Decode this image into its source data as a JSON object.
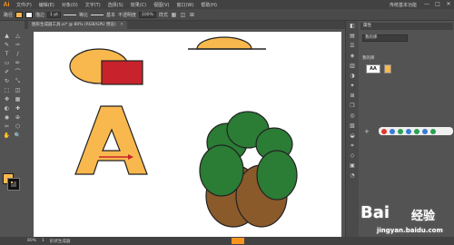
{
  "app": {
    "logo": "Ai"
  },
  "menu": {
    "items": [
      "文件(F)",
      "编辑(E)",
      "对象(O)",
      "文字(T)",
      "选择(S)",
      "效果(C)",
      "视图(V)",
      "窗口(W)",
      "帮助(H)"
    ]
  },
  "window": {
    "workspace": "传统基本功能",
    "minimize": "—",
    "maximize": "□",
    "close": "✕"
  },
  "control": {
    "selection_label": "路径",
    "stroke_label": "描边",
    "stroke_weight": "1 pt",
    "uniform_label": "等比",
    "basic_label": "基本",
    "opacity_label": "不透明度",
    "opacity_value": "100%",
    "style_label": "样式"
  },
  "document": {
    "tab_title": "图形生成器工具.ai* @ 80% (RGB/GPU 预览)",
    "close": "✕",
    "left_label": "显示设置"
  },
  "toolbar": {
    "tools": [
      "▲",
      "△",
      "✎",
      "✑",
      "T",
      "/",
      "▭",
      "✏",
      "✐",
      "⌒",
      "↻",
      "⤡",
      "⬚",
      "◫",
      "✥",
      "▦",
      "◐",
      "✚",
      "◉",
      "⊕",
      "✂",
      "⬡",
      "✋",
      "🔍"
    ]
  },
  "panel": {
    "header": "属性",
    "dropdown": "我的库",
    "library_title": "我的库",
    "library_item_text": "AA",
    "strip_icons": [
      "◧",
      "▤",
      "☰",
      "◈",
      "▥",
      "◑",
      "✦",
      "⊞",
      "❒",
      "◎",
      "▧",
      "◒",
      "⌗",
      "◇",
      "▣",
      "◔"
    ]
  },
  "floatbar": {
    "plus": "+"
  },
  "status": {
    "zoom": "80%",
    "page": "1",
    "tool_name": "形状生成器"
  },
  "watermark": {
    "brand_a": "Bai",
    "brand_b": "经验",
    "url": "jingyan.baidu.com"
  },
  "colors": {
    "fill_orange": "#f8b84e",
    "rect_red": "#c8232c",
    "tree_green": "#2b7c35",
    "trunk_brown": "#8b5a2b",
    "accent": "#f7931e"
  }
}
